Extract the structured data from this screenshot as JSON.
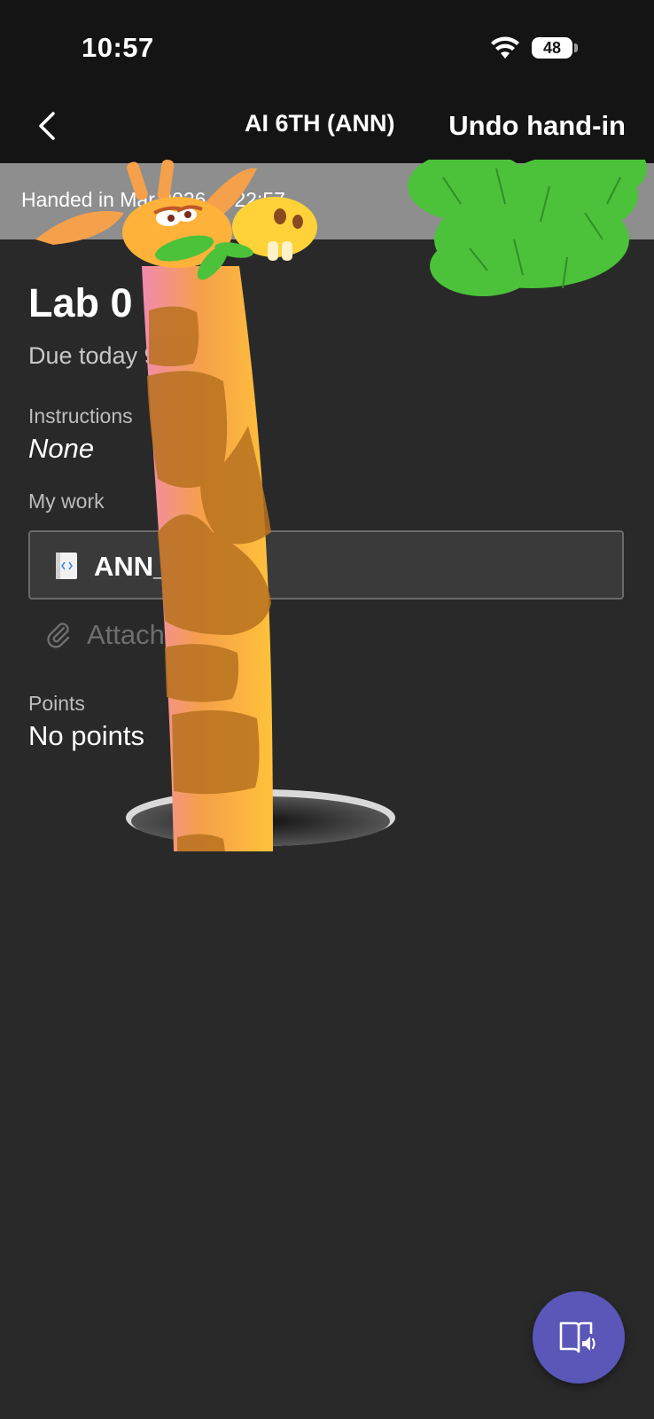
{
  "status_bar": {
    "time": "10:57",
    "battery": "48",
    "icons": [
      "wifi-icon",
      "battery-icon"
    ]
  },
  "nav": {
    "title": "AI 6TH (ANN)",
    "undo_label": "Undo hand-in",
    "back_icon": "chevron-left-icon"
  },
  "banner": {
    "text": "Handed in        Mar 2026 at 22:57"
  },
  "assignment": {
    "title": "Lab 0",
    "due": "Due today          9",
    "instructions_label": "Instructions",
    "instructions_value": "None",
    "my_work_label": "My work",
    "file_name": "ANN_             .pynb",
    "attach_label": "Attach          ew",
    "points_label": "Points",
    "points_value": "No points"
  },
  "fab": {
    "icon": "immersive-reader-icon"
  },
  "colors": {
    "background": "#292929",
    "header": "#141414",
    "banner": "#8e8e8e",
    "fab": "#5a57b8"
  }
}
